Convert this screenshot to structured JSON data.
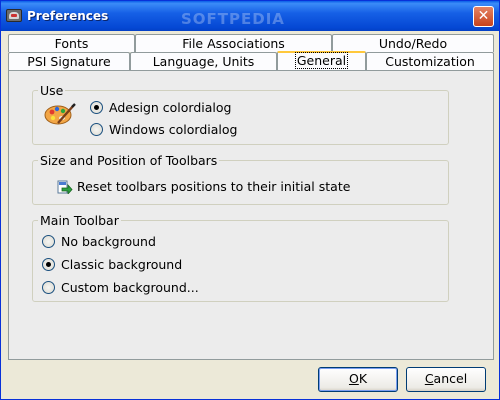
{
  "window": {
    "title": "Preferences",
    "watermark": "SOFTPEDIA",
    "close_glyph": "✕"
  },
  "tabs": {
    "row1": [
      {
        "label": "Fonts"
      },
      {
        "label": "File Associations"
      },
      {
        "label": "Undo/Redo"
      }
    ],
    "row2": [
      {
        "label": "PSI Signature"
      },
      {
        "label": "Language, Units"
      },
      {
        "label": "General",
        "active": true
      },
      {
        "label": "Customization"
      }
    ]
  },
  "use_group": {
    "title": "Use",
    "icon": "palette-icon",
    "options": [
      {
        "label": "Adesign colordialog",
        "checked": true
      },
      {
        "label": "Windows colordialog",
        "checked": false
      }
    ]
  },
  "toolbars_group": {
    "title": "Size and Position of Toolbars",
    "icon": "reset-arrow-icon",
    "action_label": "Reset toolbars positions to their initial state"
  },
  "main_toolbar_group": {
    "title": "Main Toolbar",
    "options": [
      {
        "label": "No background",
        "checked": false
      },
      {
        "label": "Classic background",
        "checked": true
      },
      {
        "label": "Custom background...",
        "checked": false
      }
    ]
  },
  "buttons": {
    "ok": {
      "mnemonic": "O",
      "rest": "K"
    },
    "cancel": {
      "mnemonic": "C",
      "rest": "ancel"
    }
  },
  "colors": {
    "titlebar": "#0548d4",
    "face": "#ece9d8",
    "panel": "#ececec",
    "active_tab_highlight": "#ffc83c"
  }
}
